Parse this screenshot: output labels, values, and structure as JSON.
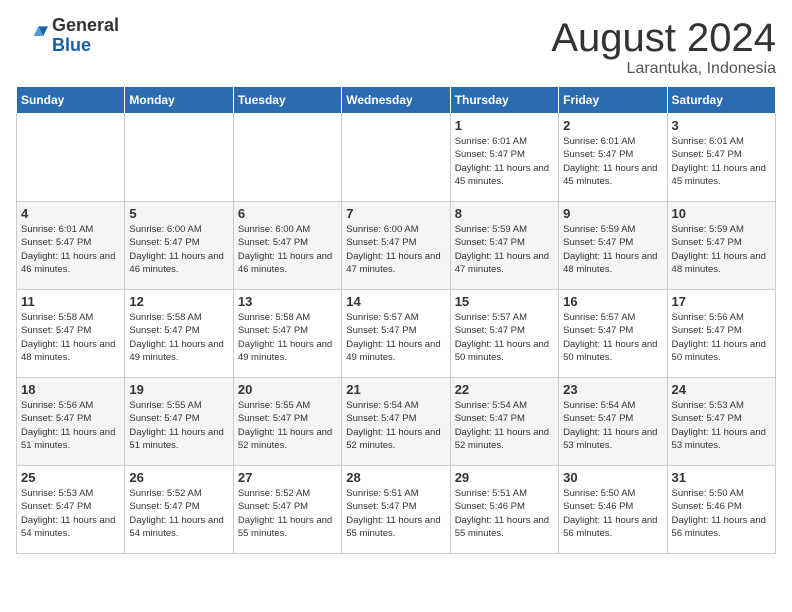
{
  "header": {
    "logo_general": "General",
    "logo_blue": "Blue",
    "title": "August 2024",
    "subtitle": "Larantuka, Indonesia"
  },
  "days_of_week": [
    "Sunday",
    "Monday",
    "Tuesday",
    "Wednesday",
    "Thursday",
    "Friday",
    "Saturday"
  ],
  "weeks": [
    [
      {
        "day": "",
        "info": ""
      },
      {
        "day": "",
        "info": ""
      },
      {
        "day": "",
        "info": ""
      },
      {
        "day": "",
        "info": ""
      },
      {
        "day": "1",
        "info": "Sunrise: 6:01 AM\nSunset: 5:47 PM\nDaylight: 11 hours\nand 45 minutes."
      },
      {
        "day": "2",
        "info": "Sunrise: 6:01 AM\nSunset: 5:47 PM\nDaylight: 11 hours\nand 45 minutes."
      },
      {
        "day": "3",
        "info": "Sunrise: 6:01 AM\nSunset: 5:47 PM\nDaylight: 11 hours\nand 45 minutes."
      }
    ],
    [
      {
        "day": "4",
        "info": "Sunrise: 6:01 AM\nSunset: 5:47 PM\nDaylight: 11 hours\nand 46 minutes."
      },
      {
        "day": "5",
        "info": "Sunrise: 6:00 AM\nSunset: 5:47 PM\nDaylight: 11 hours\nand 46 minutes."
      },
      {
        "day": "6",
        "info": "Sunrise: 6:00 AM\nSunset: 5:47 PM\nDaylight: 11 hours\nand 46 minutes."
      },
      {
        "day": "7",
        "info": "Sunrise: 6:00 AM\nSunset: 5:47 PM\nDaylight: 11 hours\nand 47 minutes."
      },
      {
        "day": "8",
        "info": "Sunrise: 5:59 AM\nSunset: 5:47 PM\nDaylight: 11 hours\nand 47 minutes."
      },
      {
        "day": "9",
        "info": "Sunrise: 5:59 AM\nSunset: 5:47 PM\nDaylight: 11 hours\nand 48 minutes."
      },
      {
        "day": "10",
        "info": "Sunrise: 5:59 AM\nSunset: 5:47 PM\nDaylight: 11 hours\nand 48 minutes."
      }
    ],
    [
      {
        "day": "11",
        "info": "Sunrise: 5:58 AM\nSunset: 5:47 PM\nDaylight: 11 hours\nand 48 minutes."
      },
      {
        "day": "12",
        "info": "Sunrise: 5:58 AM\nSunset: 5:47 PM\nDaylight: 11 hours\nand 49 minutes."
      },
      {
        "day": "13",
        "info": "Sunrise: 5:58 AM\nSunset: 5:47 PM\nDaylight: 11 hours\nand 49 minutes."
      },
      {
        "day": "14",
        "info": "Sunrise: 5:57 AM\nSunset: 5:47 PM\nDaylight: 11 hours\nand 49 minutes."
      },
      {
        "day": "15",
        "info": "Sunrise: 5:57 AM\nSunset: 5:47 PM\nDaylight: 11 hours\nand 50 minutes."
      },
      {
        "day": "16",
        "info": "Sunrise: 5:57 AM\nSunset: 5:47 PM\nDaylight: 11 hours\nand 50 minutes."
      },
      {
        "day": "17",
        "info": "Sunrise: 5:56 AM\nSunset: 5:47 PM\nDaylight: 11 hours\nand 50 minutes."
      }
    ],
    [
      {
        "day": "18",
        "info": "Sunrise: 5:56 AM\nSunset: 5:47 PM\nDaylight: 11 hours\nand 51 minutes."
      },
      {
        "day": "19",
        "info": "Sunrise: 5:55 AM\nSunset: 5:47 PM\nDaylight: 11 hours\nand 51 minutes."
      },
      {
        "day": "20",
        "info": "Sunrise: 5:55 AM\nSunset: 5:47 PM\nDaylight: 11 hours\nand 52 minutes."
      },
      {
        "day": "21",
        "info": "Sunrise: 5:54 AM\nSunset: 5:47 PM\nDaylight: 11 hours\nand 52 minutes."
      },
      {
        "day": "22",
        "info": "Sunrise: 5:54 AM\nSunset: 5:47 PM\nDaylight: 11 hours\nand 52 minutes."
      },
      {
        "day": "23",
        "info": "Sunrise: 5:54 AM\nSunset: 5:47 PM\nDaylight: 11 hours\nand 53 minutes."
      },
      {
        "day": "24",
        "info": "Sunrise: 5:53 AM\nSunset: 5:47 PM\nDaylight: 11 hours\nand 53 minutes."
      }
    ],
    [
      {
        "day": "25",
        "info": "Sunrise: 5:53 AM\nSunset: 5:47 PM\nDaylight: 11 hours\nand 54 minutes."
      },
      {
        "day": "26",
        "info": "Sunrise: 5:52 AM\nSunset: 5:47 PM\nDaylight: 11 hours\nand 54 minutes."
      },
      {
        "day": "27",
        "info": "Sunrise: 5:52 AM\nSunset: 5:47 PM\nDaylight: 11 hours\nand 55 minutes."
      },
      {
        "day": "28",
        "info": "Sunrise: 5:51 AM\nSunset: 5:47 PM\nDaylight: 11 hours\nand 55 minutes."
      },
      {
        "day": "29",
        "info": "Sunrise: 5:51 AM\nSunset: 5:46 PM\nDaylight: 11 hours\nand 55 minutes."
      },
      {
        "day": "30",
        "info": "Sunrise: 5:50 AM\nSunset: 5:46 PM\nDaylight: 11 hours\nand 56 minutes."
      },
      {
        "day": "31",
        "info": "Sunrise: 5:50 AM\nSunset: 5:46 PM\nDaylight: 11 hours\nand 56 minutes."
      }
    ]
  ]
}
